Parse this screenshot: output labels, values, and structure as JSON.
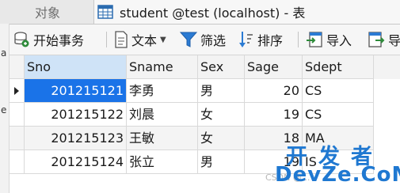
{
  "tabs": [
    {
      "label": "对象",
      "active": false
    },
    {
      "label": "student @test (localhost) - 表",
      "active": true
    }
  ],
  "left_fragments": [
    "a",
    "e"
  ],
  "toolbar": {
    "begin_transaction": "开始事务",
    "text": "文本",
    "filter": "筛选",
    "sort": "排序",
    "import": "导入",
    "export_partial": "导"
  },
  "grid": {
    "columns": [
      "Sno",
      "Sname",
      "Sex",
      "Sage",
      "Sdept"
    ],
    "rows": [
      {
        "Sno": "201215121",
        "Sname": "李勇",
        "Sex": "男",
        "Sage": "20",
        "Sdept": "CS"
      },
      {
        "Sno": "201215122",
        "Sname": "刘晨",
        "Sex": "女",
        "Sage": "19",
        "Sdept": "CS"
      },
      {
        "Sno": "201215123",
        "Sname": "王敏",
        "Sex": "女",
        "Sage": "18",
        "Sdept": "MA"
      },
      {
        "Sno": "201215124",
        "Sname": "张立",
        "Sex": "男",
        "Sage": "19",
        "Sdept": "IS"
      }
    ],
    "selected_row": 1
  },
  "watermark": {
    "top": "开发者",
    "bottom": "DevZe.CoM",
    "faint": "CSDN @..."
  },
  "colors": {
    "selection": "#1a73e8",
    "header_active": "#cfe3f7",
    "watermark": "#1f78d1"
  }
}
